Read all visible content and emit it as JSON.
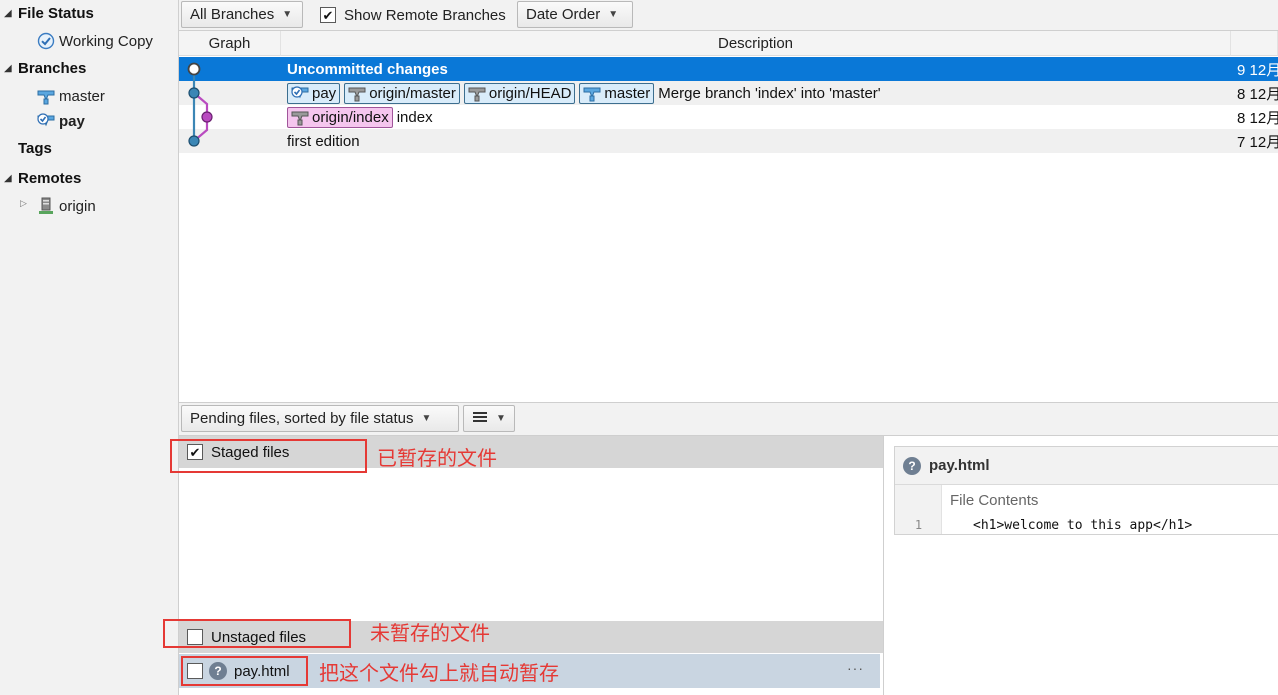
{
  "sidebar": {
    "file_status": "File Status",
    "working_copy": "Working Copy",
    "branches": "Branches",
    "branch_items": [
      "master",
      "pay"
    ],
    "tags": "Tags",
    "remotes": "Remotes",
    "remote_items": [
      "origin"
    ]
  },
  "toolbar": {
    "branches_select": "All Branches",
    "show_remote": "Show Remote Branches",
    "show_remote_checked": true,
    "order_select": "Date Order"
  },
  "table": {
    "col_graph": "Graph",
    "col_description": "Description",
    "rows": [
      {
        "description": "Uncommitted changes",
        "date": "9 12月",
        "refs": []
      },
      {
        "description": "Merge branch 'index' into 'master'",
        "date": "8 12月",
        "refs": [
          "pay",
          "origin/master",
          "origin/HEAD",
          "master"
        ]
      },
      {
        "description": "index",
        "date": "8 12月",
        "refs": [
          "origin/index"
        ]
      },
      {
        "description": "first edition",
        "date": "7 12月",
        "refs": []
      }
    ]
  },
  "pending": {
    "sort_select": "Pending files, sorted by file status",
    "view_icon": "list-view-icon"
  },
  "files": {
    "staged_label": "Staged files",
    "staged_checked": true,
    "unstaged_label": "Unstaged files",
    "unstaged_checked": false,
    "unstaged_items": [
      {
        "name": "pay.html",
        "checked": false
      }
    ],
    "more": "···"
  },
  "diff": {
    "file_name": "pay.html",
    "section": "File Contents",
    "lines": [
      {
        "num": "1",
        "code": "<h1>welcome to this app</h1>"
      }
    ]
  },
  "annotations": {
    "staged": "已暂存的文件",
    "unstaged": "未暂存的文件",
    "auto_stage": "把这个文件勾上就自动暂存"
  },
  "colors": {
    "selection": "#0a78d7",
    "annotation": "#e53935",
    "graph_main": "#3b86b5",
    "graph_branch": "#b94bc0",
    "tag_bg": "#d9ecfa",
    "tag_pink_bg": "#f5c6ee"
  }
}
